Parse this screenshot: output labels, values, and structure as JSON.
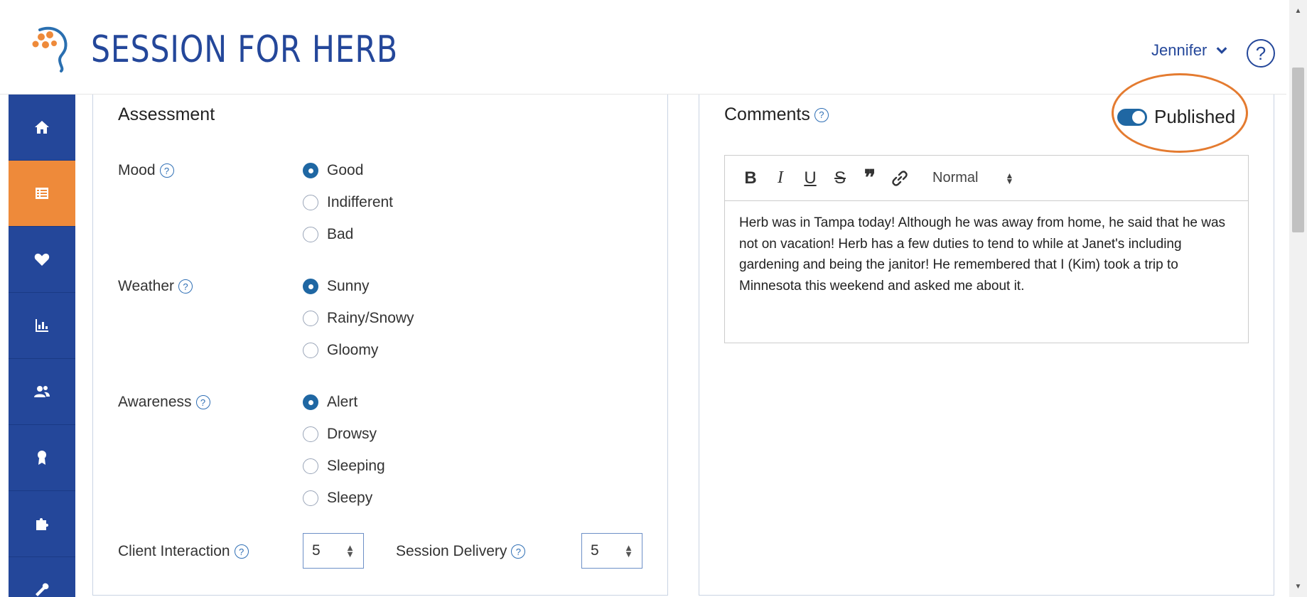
{
  "header": {
    "title": "SESSION FOR HERB",
    "user_name": "Jennifer",
    "help_label": "?"
  },
  "sidebar": {
    "items": [
      {
        "icon": "home-icon",
        "active": false
      },
      {
        "icon": "list-icon",
        "active": true
      },
      {
        "icon": "heart-icon",
        "active": false
      },
      {
        "icon": "bar-chart-icon",
        "active": false
      },
      {
        "icon": "users-icon",
        "active": false
      },
      {
        "icon": "award-icon",
        "active": false
      },
      {
        "icon": "puzzle-icon",
        "active": false
      },
      {
        "icon": "wrench-icon",
        "active": false
      }
    ]
  },
  "assessment": {
    "title": "Assessment",
    "mood": {
      "label": "Mood",
      "options": [
        "Good",
        "Indifferent",
        "Bad"
      ],
      "selected": "Good"
    },
    "weather": {
      "label": "Weather",
      "options": [
        "Sunny",
        "Rainy/Snowy",
        "Gloomy"
      ],
      "selected": "Sunny"
    },
    "awareness": {
      "label": "Awareness",
      "options": [
        "Alert",
        "Drowsy",
        "Sleeping",
        "Sleepy"
      ],
      "selected": "Alert"
    },
    "client_interaction": {
      "label": "Client Interaction",
      "value": "5"
    },
    "session_delivery": {
      "label": "Session Delivery",
      "value": "5"
    }
  },
  "comments": {
    "title": "Comments",
    "published_label": "Published",
    "published": true,
    "toolbar": {
      "bold": "B",
      "italic": "I",
      "underline": "U",
      "strike": "S",
      "quote": "❞",
      "format": "Normal"
    },
    "text": "Herb was in Tampa today! Although he was away from home, he said that he was not on vacation! Herb has a few duties to tend to while at Janet's including gardening and being the janitor! He remembered that I (Kim) took a trip to Minnesota this weekend and asked me about it."
  },
  "colors": {
    "brand": "#24479a",
    "active": "#ee8a3a",
    "radio": "#1f67a3",
    "highlight": "#e47b30"
  }
}
